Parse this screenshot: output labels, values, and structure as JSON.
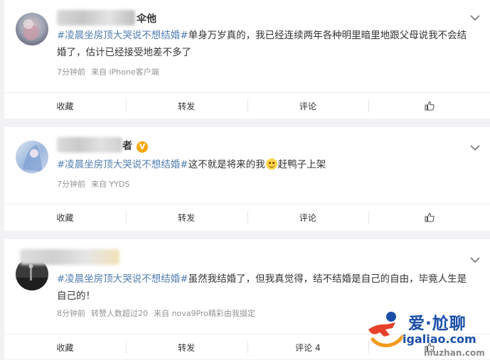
{
  "posts": [
    {
      "username": "伞他",
      "hashtag": "#凌晨坐房顶大哭说不想结婚#",
      "text": "单身万岁真的，我已经连续两年各种明里暗里地跟父母说我不会结婚了，估计已经接受地差不多了",
      "time": "7分钟前",
      "source": "来自 iPhone客户端",
      "actions": {
        "collect": "收藏",
        "repost": "转发",
        "comment": "评论"
      }
    },
    {
      "username": "者",
      "hashtag": "#凌晨坐房顶大哭说不想结婚#",
      "text_before_emoji": "这不就是将来的我",
      "text_after_emoji": "赶鸭子上架",
      "time": "7分钟前",
      "source": "来自 YYDS",
      "actions": {
        "collect": "收藏",
        "repost": "转发",
        "comment": "评论"
      }
    },
    {
      "hashtag": "#凌晨坐房顶大哭说不想结婚#",
      "text": "虽然我结婚了，但我真觉得，结不结婚是自己的自由，毕竟人生是自己的！",
      "time": "8分钟前",
      "likes_note": "转赞人数超过20",
      "source": "来自 nova9Pro精彩由我掇定",
      "actions": {
        "collect": "收藏",
        "repost": "转发",
        "comment": "评论 4"
      }
    }
  ],
  "watermark": {
    "brand": "爱·尬聊",
    "domain": "igaliao.com",
    "domain2": "niuzhan.com"
  },
  "colors": {
    "hashtag": "#507daf",
    "background": "#f2f2f5",
    "verified_badge": "#f7a600"
  }
}
